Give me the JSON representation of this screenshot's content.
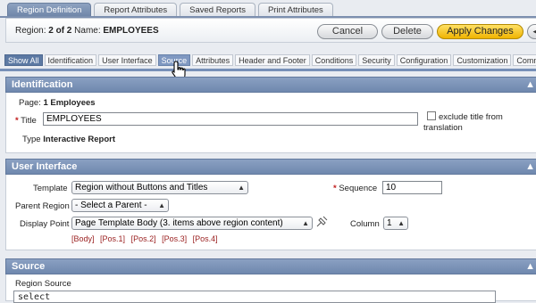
{
  "tabs": [
    {
      "label": "Region Definition",
      "active": true
    },
    {
      "label": "Report Attributes",
      "active": false
    },
    {
      "label": "Saved Reports",
      "active": false
    },
    {
      "label": "Print Attributes",
      "active": false
    }
  ],
  "region": {
    "prefix": "Region:",
    "number": "2 of 2",
    "name_label": "Name:",
    "name": "EMPLOYEES"
  },
  "buttons": {
    "cancel": "Cancel",
    "delete": "Delete",
    "apply": "Apply Changes",
    "prev_icon": "chevron-left-icon"
  },
  "filters": [
    {
      "label": "Show All",
      "state": "active"
    },
    {
      "label": "Identification",
      "state": ""
    },
    {
      "label": "User Interface",
      "state": ""
    },
    {
      "label": "Source",
      "state": "hover"
    },
    {
      "label": "Attributes",
      "state": ""
    },
    {
      "label": "Header and Footer",
      "state": ""
    },
    {
      "label": "Conditions",
      "state": ""
    },
    {
      "label": "Security",
      "state": ""
    },
    {
      "label": "Configuration",
      "state": ""
    },
    {
      "label": "Customization",
      "state": ""
    },
    {
      "label": "Comm",
      "state": ""
    }
  ],
  "identification": {
    "title": "Identification",
    "page_label": "Page:",
    "page_value": "1 Employees",
    "title_label": "Title",
    "title_value": "EMPLOYEES",
    "exclude_label_1": "exclude title from",
    "exclude_label_2": "translation",
    "type_label": "Type",
    "type_value": "Interactive Report"
  },
  "user_interface": {
    "title": "User Interface",
    "template_label": "Template",
    "template_value": "Region without Buttons and Titles",
    "sequence_label": "Sequence",
    "sequence_value": "10",
    "parent_label": "Parent Region",
    "parent_value": "- Select a Parent -",
    "display_label": "Display Point",
    "display_value": "Page Template Body (3. items above region content)",
    "column_label": "Column",
    "column_value": "1",
    "positions": [
      "[Body]",
      "[Pos.1]",
      "[Pos.2]",
      "[Pos.3]",
      "[Pos.4]"
    ]
  },
  "source": {
    "title": "Source",
    "region_source_label": "Region Source",
    "region_source_value": "select"
  },
  "icons": {
    "collapse": "caret-up-icon",
    "pick": "flashlight-icon",
    "cursor": "hand-pointer-icon"
  },
  "colors": {
    "header": "#7a91b5",
    "apply_button": "#f5c518",
    "required": "#c01b1b",
    "link": "#9b2222"
  }
}
